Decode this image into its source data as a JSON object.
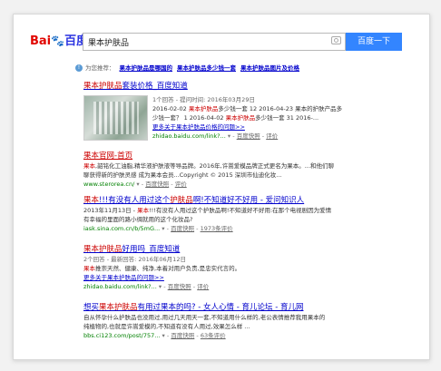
{
  "logo": {
    "bai": "Bai",
    "du": "百度"
  },
  "search": {
    "query": "果本护肤品",
    "button": "百度一下"
  },
  "rec": {
    "label": "为您推荐：",
    "items": [
      "果本护肤品是哪国的",
      "果本护肤品多少钱一套",
      "果本护肤品图片及价格"
    ]
  },
  "results": [
    {
      "title_pre": "果本护肤品",
      "title_post": "套装价格_百度知道",
      "meta": "1个回答 - 提问时间: 2016年03月29日",
      "l1_pre": "2016-02-02 ",
      "l1_hl": "果本护肤品",
      "l1_post": "多少钱一套 12 2016-04-23 果本的护肤产品多",
      "l2_pre": "少钱一套？ 1 2016-04-02 ",
      "l2_hl": "果本护肤品",
      "l2_post": "多少钱一套 31 2016-...",
      "more": "更多关于果本护肤品价格的问题>>",
      "url": "zhidao.baidu.com/link?...",
      "snap": "百度快照",
      "eval": "评价"
    },
    {
      "title": "果本官网-首页",
      "l1_hl": "果本",
      "l1_post": ",韶铭化工油脂,精华液护肤液等导品牌。2016年,许嵩爱模品牌正式更名为果本。...和他们聊",
      "l2": "聊获得新的护肤灵感 成为果本会员...Copyright © 2015 深圳市仙迪化妆...",
      "url": "www.sterorea.cn/",
      "snap": "百度快照",
      "eval": "评价"
    },
    {
      "title_hl1": "果本",
      "title_mid": "!!!有没有人用过这个",
      "title_hl2": "护肤品",
      "title_post": "啊!不知道好不好用 - 爱问知识人",
      "l1_pre": "2013年11月13日 - ",
      "l1_hl": "果本",
      "l1_post": "!!!有没有人用过这个护肤品啊!不知道好不好用:在那个电视剧因为爱情",
      "l2": "有幸福的里面的路小绸就用的这个化妆品?",
      "url": "iask.sina.com.cn/b/5mG...",
      "snap": "百度快照",
      "eval": "1973条评价"
    },
    {
      "title_pre": "果本护肤品",
      "title_post": "好用吗_百度知道",
      "meta": "2个回答 - 最新回答: 2016年06月12日",
      "l1_hl": "果本",
      "l1_post": "推崇天然、健康、纯净,本着对用户负责,是忠实代言的。",
      "more": "更多关于果本护肤品的问题>>",
      "url": "zhidao.baidu.com/link?...",
      "snap": "百度快照",
      "eval": "评价"
    },
    {
      "title_pre": "想买",
      "title_hl": "果本护肤品",
      "title_post": "有用过果本的吗? - 女人心情 - 育儿论坛 - 育儿网",
      "l1": "自从怀孕什么护肤品也没用过,用过几天用天一套,不知道用什么样的,老公表情推荐我用果本的",
      "l2": "纯植物的,也就是许嵩爱模的,不知道有没有人用过,效果怎么样 ...",
      "url": "bbs.ci123.com/post/757...",
      "snap": "百度快照",
      "eval": "63条评价"
    }
  ]
}
